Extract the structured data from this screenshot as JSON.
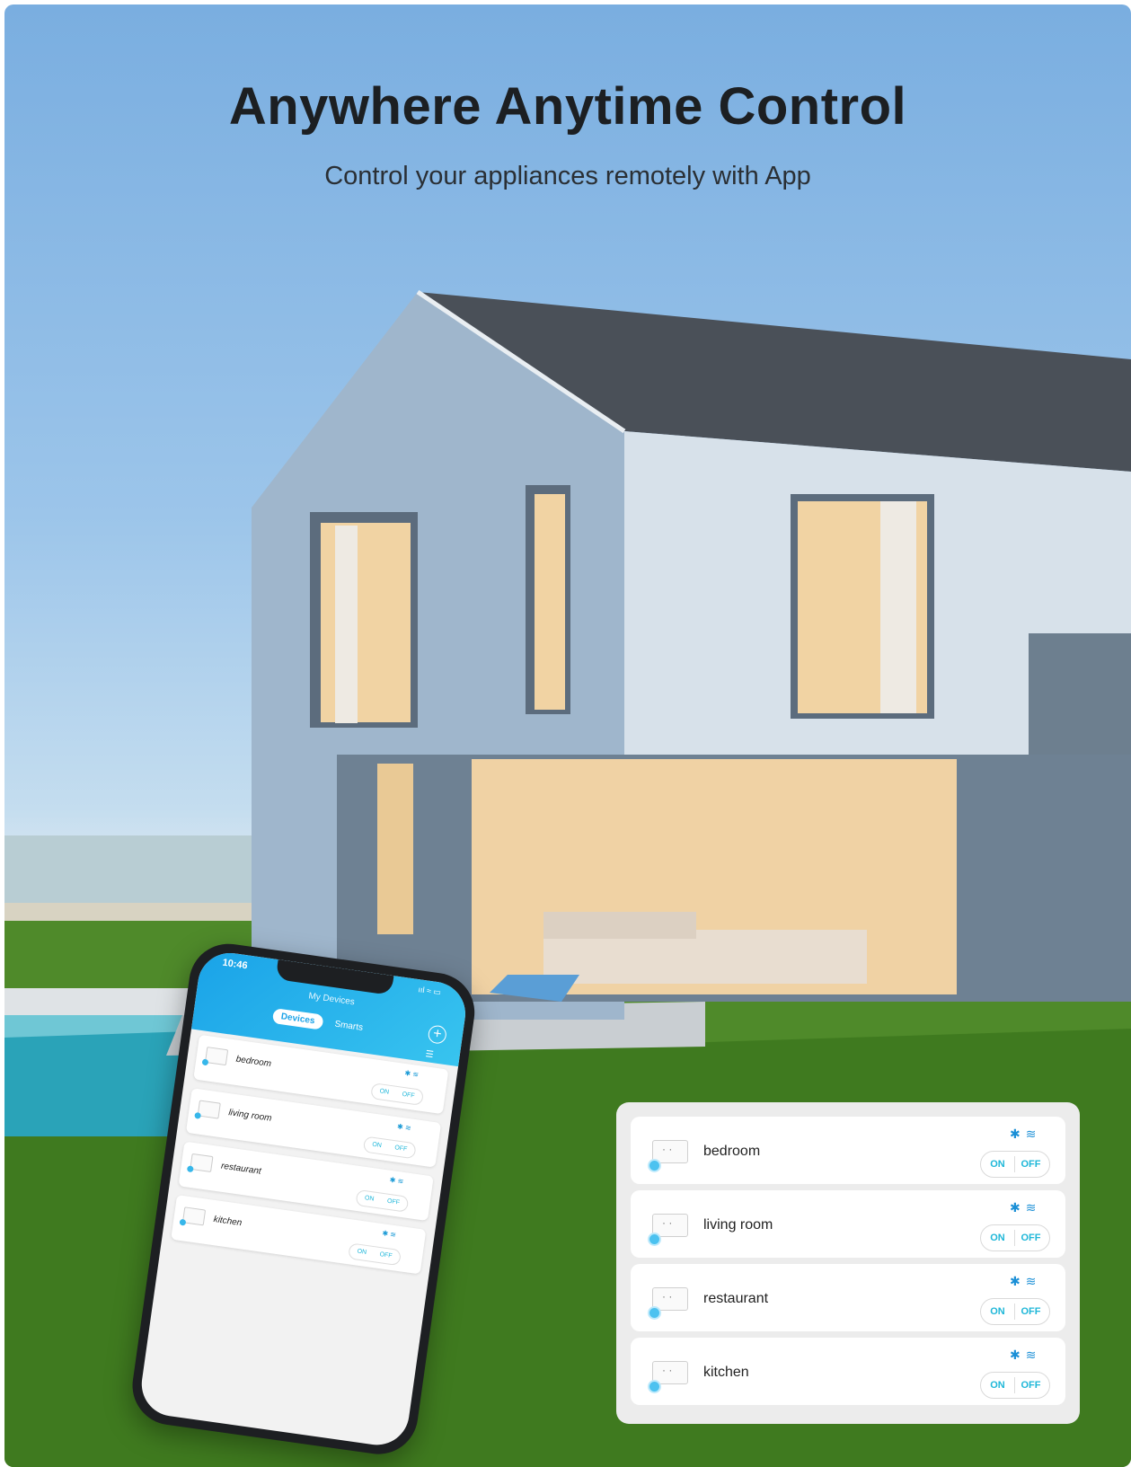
{
  "header": {
    "title": "Anywhere Anytime Control",
    "subtitle": "Control your appliances remotely with App"
  },
  "phone": {
    "time": "10:46",
    "status": "ııl ≈ ▭",
    "screen_title": "My Devices",
    "tabs": [
      "Devices",
      "Smarts"
    ],
    "active_tab": "Devices",
    "add_label": "+",
    "devices": [
      {
        "name": "bedroom",
        "on_label": "ON",
        "off_label": "OFF"
      },
      {
        "name": "living room",
        "on_label": "ON",
        "off_label": "OFF"
      },
      {
        "name": "restaurant",
        "on_label": "ON",
        "off_label": "OFF"
      },
      {
        "name": "kitchen",
        "on_label": "ON",
        "off_label": "OFF"
      }
    ]
  },
  "panel": {
    "devices": [
      {
        "name": "bedroom",
        "on_label": "ON",
        "off_label": "OFF",
        "icons": [
          "bluetooth-icon",
          "wifi-icon"
        ]
      },
      {
        "name": "living room",
        "on_label": "ON",
        "off_label": "OFF",
        "icons": [
          "bluetooth-icon",
          "wifi-icon"
        ]
      },
      {
        "name": "restaurant",
        "on_label": "ON",
        "off_label": "OFF",
        "icons": [
          "bluetooth-icon",
          "wifi-icon"
        ]
      },
      {
        "name": "kitchen",
        "on_label": "ON",
        "off_label": "OFF",
        "icons": [
          "bluetooth-icon",
          "wifi-icon"
        ]
      }
    ]
  },
  "colors": {
    "accent": "#1fb7d8",
    "app_header": "#1aa3e8",
    "sky": "#7aaee0",
    "grass": "#4f8a2a"
  }
}
